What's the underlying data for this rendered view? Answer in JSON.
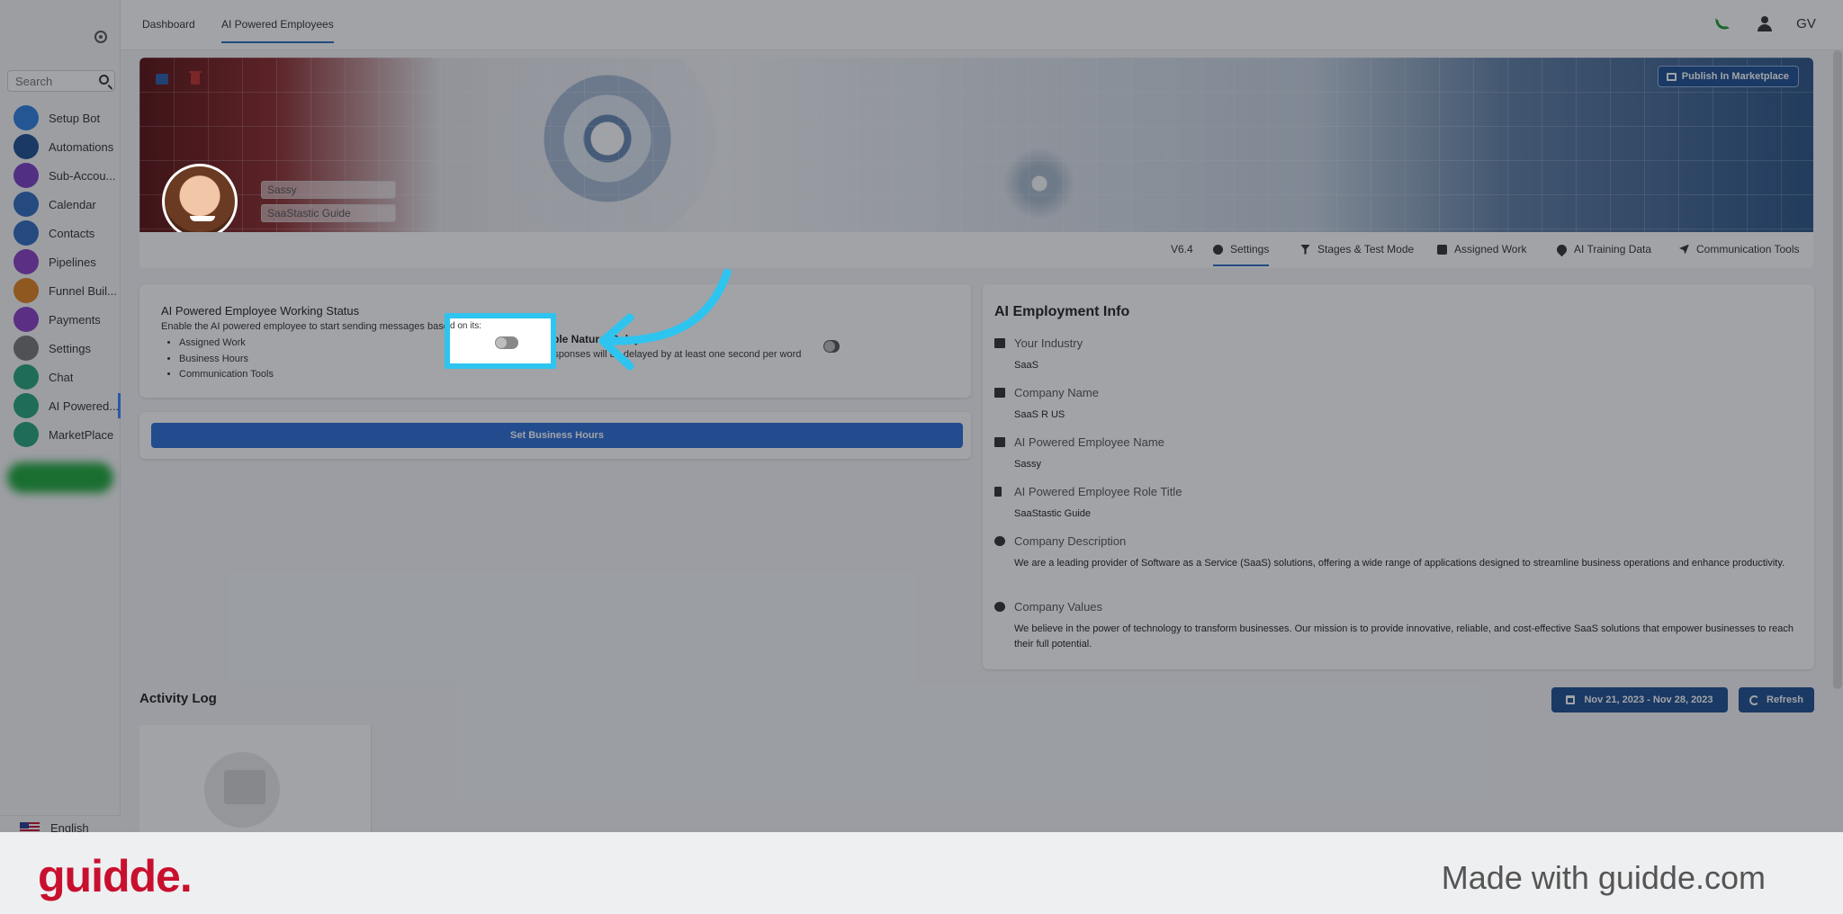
{
  "sidebar": {
    "search_placeholder": "Search",
    "items": [
      {
        "label": "Setup Bot",
        "icon": "bolt-icon",
        "color": "#2f7fe0"
      },
      {
        "label": "Automations",
        "icon": "automation-icon",
        "color": "#1f4f8f"
      },
      {
        "label": "Sub-Accou...",
        "icon": "person-icon",
        "color": "#7b3fc4"
      },
      {
        "label": "Calendar",
        "icon": "calendar-icon",
        "color": "#2f6bbf"
      },
      {
        "label": "Contacts",
        "icon": "contacts-icon",
        "color": "#2f6bbf"
      },
      {
        "label": "Pipelines",
        "icon": "dollar-icon",
        "color": "#8a3fc4"
      },
      {
        "label": "Funnel Buil...",
        "icon": "funnel-icon",
        "color": "#e0821f"
      },
      {
        "label": "Payments",
        "icon": "card-icon",
        "color": "#8a3fc4"
      },
      {
        "label": "Settings",
        "icon": "gear-icon",
        "color": "#777777"
      },
      {
        "label": "Chat",
        "icon": "chat-icon",
        "color": "#27a37e"
      },
      {
        "label": "AI Powered...",
        "icon": "ai-chat-icon",
        "color": "#27a37e"
      },
      {
        "label": "MarketPlace",
        "icon": "marketplace-icon",
        "color": "#27a37e"
      }
    ],
    "language": "English"
  },
  "topbar": {
    "tabs": [
      "Dashboard",
      "AI Powered Employees"
    ],
    "user_initials": "GV"
  },
  "banner": {
    "publish_label": "Publish In Marketplace",
    "employee_name": "Sassy",
    "employee_role": "SaaStastic Guide"
  },
  "settings_tabs": {
    "version": "V6.4",
    "items": [
      "Settings",
      "Stages & Test Mode",
      "Assigned Work",
      "AI Training Data",
      "Communication Tools"
    ]
  },
  "working_status": {
    "title": "AI Powered Employee Working Status",
    "description": "Enable the AI powered employee to start sending messages based on its:",
    "bullets": [
      "Assigned Work",
      "Business Hours",
      "Communication Tools"
    ],
    "toggle_label": "Enable Natural Delay",
    "toggle_sub": "AI responses will be delayed by at least one second per word",
    "highlight_text": "d on its:"
  },
  "business_hours_button": "Set Business Hours",
  "employment_info": {
    "title": "AI Employment Info",
    "rows": [
      {
        "label": "Your Industry",
        "value": "SaaS",
        "icon": "industry-icon"
      },
      {
        "label": "Company Name",
        "value": "SaaS R US",
        "icon": "building-icon"
      },
      {
        "label": "AI Powered Employee Name",
        "value": "Sassy",
        "icon": "briefcase-icon"
      },
      {
        "label": "AI Powered Employee Role Title",
        "value": "SaaStastic Guide",
        "icon": "flag-icon"
      },
      {
        "label": "Company Description",
        "value": "We are a leading provider of Software as a Service (SaaS) solutions, offering a wide range of applications designed to streamline business operations and enhance productivity.",
        "icon": "info-icon"
      },
      {
        "label": "Company Values",
        "value": "We believe in the power of technology to transform businesses. Our mission is to provide innovative, reliable, and cost-effective SaaS solutions that empower businesses to reach their full potential.",
        "icon": "info-icon"
      }
    ]
  },
  "activity_log": {
    "title": "Activity Log",
    "date_range": "Nov 21, 2023 - Nov 28, 2023",
    "refresh_label": "Refresh"
  },
  "footer": {
    "brand": "guidde.",
    "made_with": "Made with guidde.com"
  },
  "colors": {
    "accent_blue": "#2d6ed6",
    "dark_blue": "#1f4f8f",
    "highlight_cyan": "#2ec4f0",
    "brand_red": "#c8102e"
  }
}
